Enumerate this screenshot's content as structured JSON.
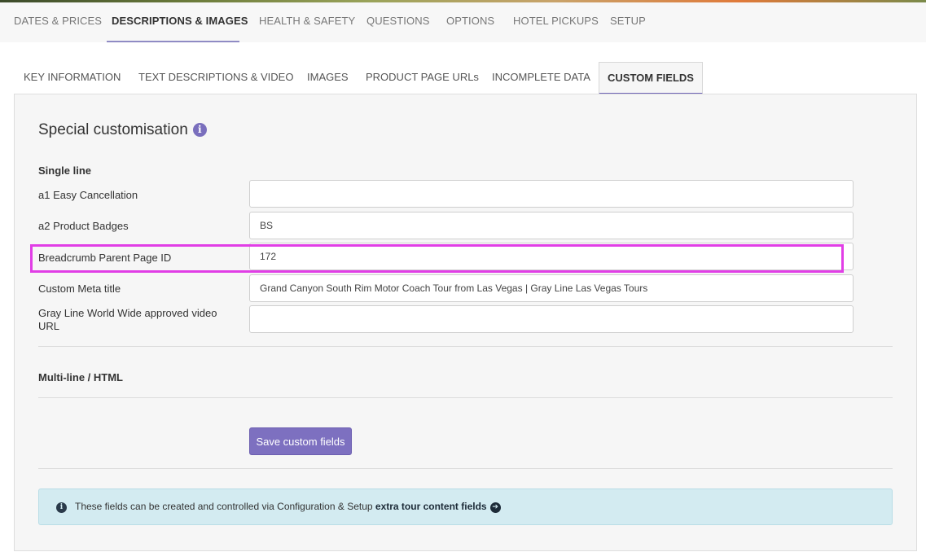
{
  "main_tabs": [
    {
      "label": "DATES & PRICES"
    },
    {
      "label": "DESCRIPTIONS & IMAGES"
    },
    {
      "label": "HEALTH & SAFETY"
    },
    {
      "label": "QUESTIONS"
    },
    {
      "label": "OPTIONS"
    },
    {
      "label": "HOTEL PICKUPS"
    },
    {
      "label": "SETUP"
    }
  ],
  "sub_tabs": [
    {
      "label": "KEY INFORMATION"
    },
    {
      "label": "TEXT DESCRIPTIONS & VIDEO"
    },
    {
      "label": "IMAGES"
    },
    {
      "label": "PRODUCT PAGE URLs"
    },
    {
      "label": "INCOMPLETE DATA"
    },
    {
      "label": "CUSTOM FIELDS"
    }
  ],
  "section": {
    "title": "Special customisation",
    "info_glyph": "i"
  },
  "single_line": {
    "heading": "Single line",
    "fields": [
      {
        "label": "a1 Easy Cancellation",
        "value": ""
      },
      {
        "label": "a2 Product Badges",
        "value": "BS"
      },
      {
        "label": "Breadcrumb Parent Page ID",
        "value": "172"
      },
      {
        "label": "Custom Meta title",
        "value": "Grand Canyon South Rim Motor Coach Tour from Las Vegas | Gray Line Las Vegas Tours"
      },
      {
        "label": "Gray Line World Wide approved video URL",
        "value": ""
      }
    ]
  },
  "multi_line": {
    "heading": "Multi-line / HTML"
  },
  "save_button": {
    "label": "Save custom fields"
  },
  "alert": {
    "info_glyph": "i",
    "text": "These fields can be created and controlled via Configuration & Setup ",
    "link": "extra tour content fields",
    "arrow_glyph": "➔"
  },
  "colors": {
    "accent": "#7d70c0",
    "highlight": "#e13ee6",
    "alert_bg": "#d3ebf1",
    "panel_bg": "#f6f6f6"
  },
  "icons": [
    "info-circle-icon",
    "arrow-circle-right-icon"
  ]
}
